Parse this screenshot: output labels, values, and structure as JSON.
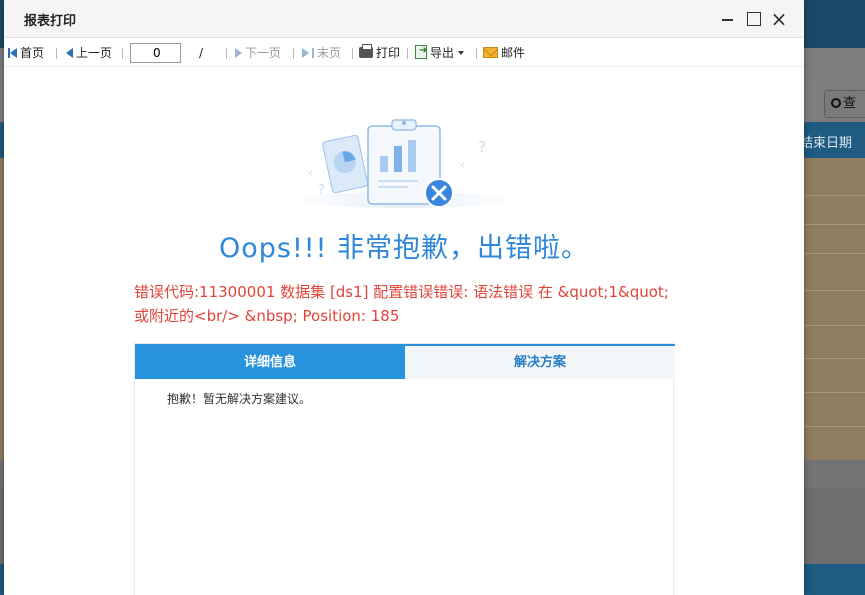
{
  "background": {
    "search_button_label": "查",
    "column_header": "结束日期"
  },
  "dialog": {
    "title": "报表打印",
    "controls": {
      "minimize": "minimize-icon",
      "maximize": "maximize-icon",
      "close": "×"
    }
  },
  "toolbar": {
    "first_page": "首页",
    "prev_page": "上一页",
    "page_input_value": "0",
    "page_separator": "/",
    "next_page": "下一页",
    "last_page": "末页",
    "print": "打印",
    "export": "导出",
    "email": "邮件"
  },
  "error": {
    "headline": "Oops!!! 非常抱歉，出错啦。",
    "message": "错误代码:11300001 数据集 [ds1] 配置错误错误: 语法错误 在 &quot;1&quot; 或附近的<br/> &nbsp; Position: 185"
  },
  "tabs": [
    {
      "label": "详细信息",
      "active": true
    },
    {
      "label": "解决方案",
      "active": false
    }
  ],
  "panel_content": "抱歉！暂无解决方案建议。",
  "colors": {
    "accent_blue": "#2793dd",
    "headline_blue": "#2f87da",
    "error_red": "#e0453a"
  }
}
